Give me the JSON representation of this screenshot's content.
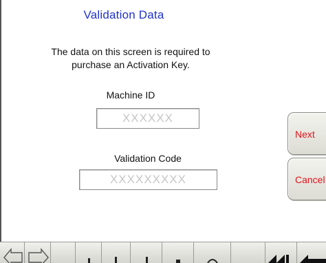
{
  "screen": {
    "title": "Validation Data",
    "description_line1": "The data on this screen is required to",
    "description_line2": "purchase an Activation Key."
  },
  "machine_id": {
    "label": "Machine ID",
    "value": "XXXXXX"
  },
  "validation_code": {
    "label": "Validation Code",
    "value": "XXXXXXXXX"
  },
  "buttons": {
    "next": "Next",
    "cancel": "Cancel"
  },
  "toolbar": {
    "items": [
      {
        "name": "back-arrow-icon"
      },
      {
        "name": "forward-arrow-icon"
      },
      {
        "name": "toolbar-key-1"
      },
      {
        "name": "toolbar-key-2"
      },
      {
        "name": "toolbar-key-3"
      },
      {
        "name": "toolbar-key-4"
      },
      {
        "name": "toolbar-key-5"
      },
      {
        "name": "toolbar-key-6"
      },
      {
        "name": "rewind-icon"
      },
      {
        "name": "left-arrow-icon"
      }
    ]
  },
  "colors": {
    "title": "#1f33c8",
    "button_text": "#e0131b",
    "placeholder_text": "#c6c6c6"
  }
}
